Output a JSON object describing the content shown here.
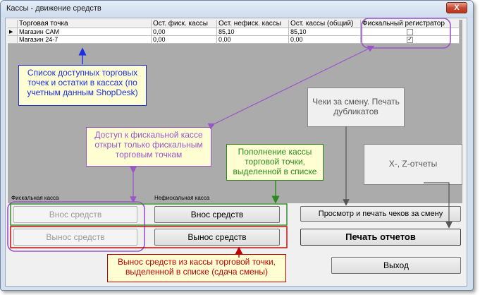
{
  "window": {
    "title": "Кассы - движение средств",
    "close_label": "X"
  },
  "grid": {
    "columns": [
      "Торговая точка",
      "Ост. фиск. кассы",
      "Ост. нефиск. кассы",
      "Ост. кассы (общий)",
      "Фискальный регистратор"
    ],
    "rows": [
      {
        "name": "Магазин САМ",
        "fiscal": "0,00",
        "nonfiscal": "85,10",
        "total": "85,10",
        "registrar": false,
        "current": true
      },
      {
        "name": "Магазин 24-7",
        "fiscal": "0,00",
        "nonfiscal": "0,00",
        "total": "0,00",
        "registrar": true,
        "current": false
      }
    ]
  },
  "groups": {
    "fiscal_label": "Фискальная касса",
    "nonfiscal_label": "Нефискальная касса"
  },
  "buttons": {
    "fiscal_in": "Внос средств",
    "fiscal_out": "Вынос средств",
    "nonfiscal_in": "Внос средств",
    "nonfiscal_out": "Вынос средств",
    "view_checks": "Просмотр и печать чеков за смену",
    "print_reports": "Печать отчетов",
    "exit": "Выход"
  },
  "notes": {
    "blue": "Список доступных торговых точек и остатки в кассах (по учетным данным ShopDesk)",
    "purple": "Доступ к фискальной кассе открыт только фискальным торговым точкам",
    "green": "Пополнение кассы торговой точки, выделенной в списке",
    "gray1": "Чеки за смену. Печать дубликатов",
    "gray2": "X-, Z-отчеты",
    "red": "Вынос средств из кассы торговой точки, выделенной в списке (сдача смены)"
  },
  "colors": {
    "blue": "#1a2ee6",
    "purple": "#9a55c9",
    "green": "#2a8a1e",
    "red": "#c00000",
    "note_bg": "#fefed2",
    "gray_note_bg": "#f0f0f0"
  }
}
